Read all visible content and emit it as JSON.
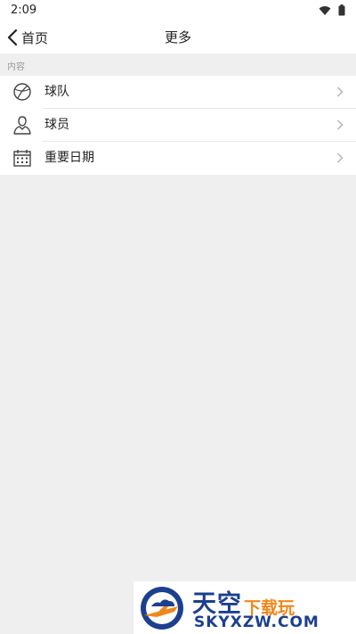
{
  "status_bar": {
    "time": "2:09"
  },
  "nav": {
    "back_label": "首页",
    "title": "更多"
  },
  "section": {
    "header": "内容"
  },
  "list": {
    "items": [
      {
        "label": "球队",
        "icon": "basketball-icon"
      },
      {
        "label": "球员",
        "icon": "player-icon"
      },
      {
        "label": "重要日期",
        "icon": "calendar-icon"
      }
    ]
  },
  "watermark": {
    "brand_main": "天空",
    "brand_sub": "下载玩",
    "domain": "SKYXZW.COM",
    "colors": {
      "blue": "#1c3f8f",
      "orange": "#f0871b"
    }
  }
}
